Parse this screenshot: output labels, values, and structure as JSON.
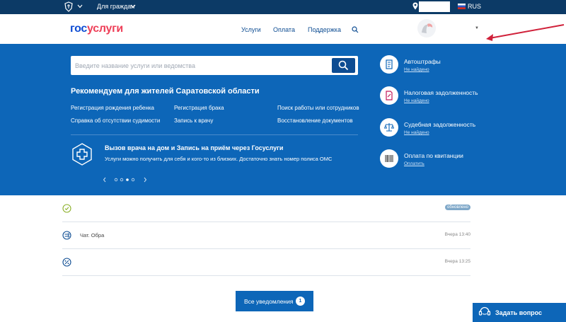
{
  "topbar": {
    "audience_label": "Для граждан",
    "language": "RUS"
  },
  "header": {
    "logo_part1": "гос",
    "logo_part2": "услуги",
    "nav": [
      "Услуги",
      "Оплата",
      "Поддержка"
    ]
  },
  "hero": {
    "search_placeholder": "Введите название услуги или ведомства",
    "recommend_title": "Рекомендуем для жителей Саратовской области",
    "recommended": [
      "Регистрация рождения ребенка",
      "Регистрация брака",
      "Поиск работы или сотрудников",
      "Справка об отсутствии судимости",
      "Запись к врачу",
      "Восстановление документов"
    ],
    "promo_title": "Вызов врача на дом и Запись на приём через Госуслуги",
    "promo_text": "Услуги можно получить для себя и кого-то из близких. Достаточно знать номер полиса ОМС",
    "side": [
      {
        "title": "Автоштрафы",
        "sub": "Не найдено",
        "icon": "fine-doc-icon"
      },
      {
        "title": "Налоговая задолженность",
        "sub": "Не найдено",
        "icon": "tax-doc-icon"
      },
      {
        "title": "Судебная задолженность",
        "sub": "Не найдено",
        "icon": "scales-icon"
      },
      {
        "title": "Оплата по квитанции",
        "sub": "Оплатить",
        "icon": "barcode-icon"
      }
    ]
  },
  "notifications": [
    {
      "text": "",
      "time": "",
      "badge": "обновлено",
      "icon": "check-circle-icon"
    },
    {
      "text": "Чат. Обра",
      "time": "Вчера 13:40",
      "badge": "",
      "icon": "chat-icon"
    },
    {
      "text": "",
      "time": "Вчера 13:25",
      "badge": "",
      "icon": "percent-icon"
    }
  ],
  "all_notifications": {
    "label": "Все уведомления",
    "count": "1"
  },
  "ask": {
    "label": "Задать вопрос"
  },
  "colors": {
    "topbar": "#0c3a66",
    "hero": "#0d66b8",
    "logo_blue": "#0d4cd3",
    "logo_red": "#ee3f58",
    "annotation_arrow": "#d0213a"
  }
}
